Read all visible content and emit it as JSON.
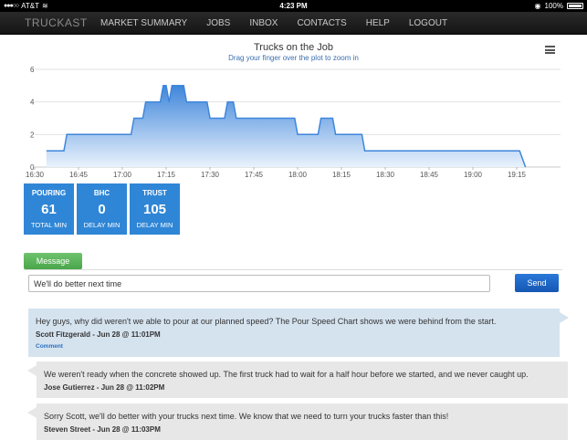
{
  "status_bar": {
    "carrier": "AT&T",
    "time": "4:23 PM",
    "battery": "100%"
  },
  "nav": {
    "brand": "TRUCKAST",
    "items": [
      "MARKET SUMMARY",
      "JOBS",
      "INBOX",
      "CONTACTS",
      "HELP",
      "LOGOUT"
    ]
  },
  "chart_data": {
    "type": "area",
    "title": "Trucks on the Job",
    "subtitle": "Drag your finger over the plot to zoom in",
    "xlabel": "",
    "ylabel": "",
    "y_ticks": [
      "0",
      "2",
      "4",
      "6"
    ],
    "x_ticks": [
      "16:30",
      "16:45",
      "17:00",
      "17:15",
      "17:30",
      "17:45",
      "18:00",
      "18:15",
      "18:30",
      "18:45",
      "19:00",
      "19:15"
    ],
    "ylim": [
      0,
      6
    ],
    "xlim_minutes": [
      990,
      1170
    ],
    "grid": true,
    "color": "#3f86db",
    "x": [
      "16:34",
      "16:40",
      "16:41",
      "17:03",
      "17:04",
      "17:07",
      "17:08",
      "17:13",
      "17:14",
      "17:15",
      "17:16",
      "17:17",
      "17:18",
      "17:21",
      "17:22",
      "17:29",
      "17:30",
      "17:35",
      "17:36",
      "17:38",
      "17:39",
      "17:59",
      "18:00",
      "18:07",
      "18:08",
      "18:12",
      "18:13",
      "18:22",
      "18:23",
      "19:16",
      "19:18"
    ],
    "y": [
      1,
      1,
      2,
      2,
      3,
      3,
      4,
      4,
      5,
      5,
      4,
      5,
      5,
      5,
      4,
      4,
      3,
      3,
      4,
      4,
      3,
      3,
      2,
      2,
      3,
      3,
      2,
      2,
      1,
      1,
      0
    ]
  },
  "tiles": [
    {
      "head": "POURING",
      "value": "61",
      "foot": "TOTAL MIN"
    },
    {
      "head": "BHC",
      "value": "0",
      "foot": "DELAY MIN"
    },
    {
      "head": "TRUST",
      "value": "105",
      "foot": "DELAY MIN"
    }
  ],
  "message": {
    "button_label": "Message",
    "input_value": "We'll do better next time",
    "send_label": "Send"
  },
  "comments": [
    {
      "text": "Hey guys, why did weren't we able to pour at our planned speed? The Pour Speed Chart shows we were behind from the start.",
      "author": "Scott Fitzgerald - Jun 28 @ 11:01PM",
      "link": "Comment"
    },
    {
      "text": "We weren't ready when the concrete showed up. The first truck had to wait for a half hour before we started, and we never caught up.",
      "author": "Jose Gutierrez - Jun 28 @ 11:02PM"
    },
    {
      "text": "Sorry Scott, we'll do better with your trucks next time. We know that we need to turn your trucks faster than this!",
      "author": "Steven Street - Jun 28 @ 11:03PM"
    }
  ]
}
